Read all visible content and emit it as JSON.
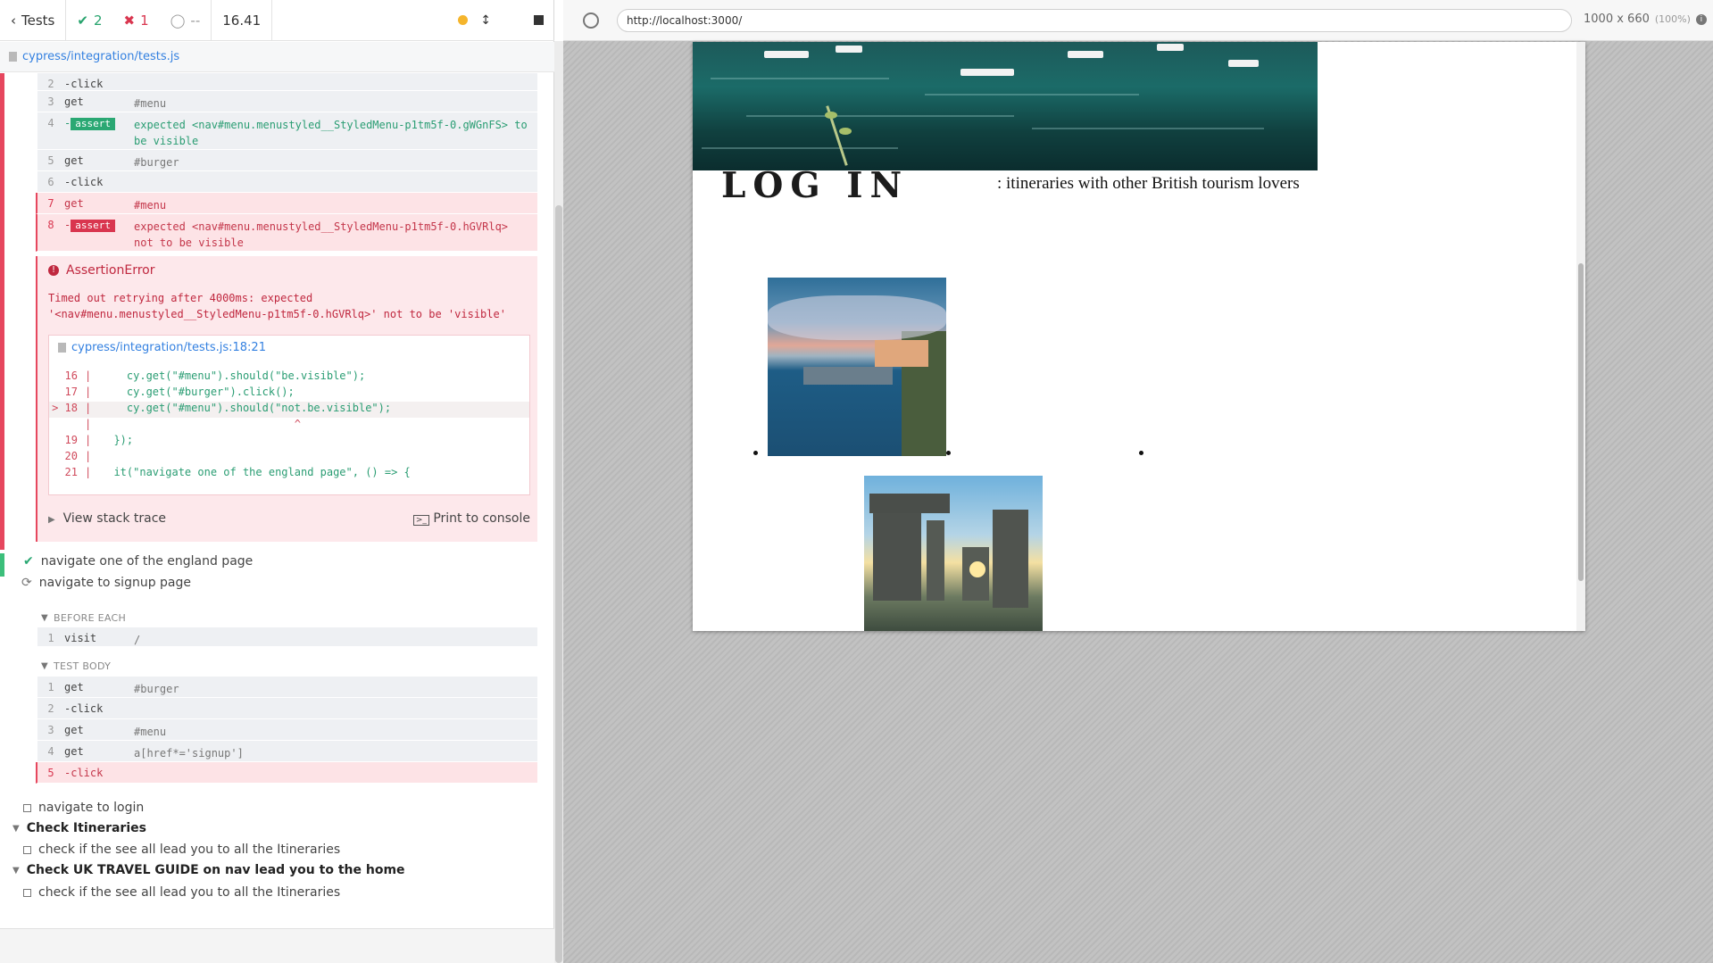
{
  "reporter": {
    "header": {
      "back_label": "Tests",
      "passed": "2",
      "failed": "1",
      "pending": "--",
      "duration": "16.41"
    },
    "spec_file": "cypress/integration/tests.js",
    "commands_top": [
      {
        "num": "2",
        "name": "-click",
        "msg": ""
      },
      {
        "num": "3",
        "name": "get",
        "msg": "#menu"
      },
      {
        "num": "4",
        "name": "-",
        "badge": "assert",
        "msg": "expected <nav#menu.menustyled__StyledMenu-p1tm5f-0.gWGnFS> to be visible"
      },
      {
        "num": "5",
        "name": "get",
        "msg": "#burger"
      },
      {
        "num": "6",
        "name": "-click",
        "msg": ""
      },
      {
        "num": "7",
        "name": "get",
        "msg": "#menu"
      },
      {
        "num": "8",
        "name": "-",
        "badge": "assert",
        "msg": "expected <nav#menu.menustyled__StyledMenu-p1tm5f-0.hGVRlq> not to be visible"
      }
    ],
    "error": {
      "title": "AssertionError",
      "message_line1": "Timed out retrying after 4000ms: expected",
      "message_line2": "'<nav#menu.menustyled__StyledMenu-p1tm5f-0.hGVRlq>' not to be 'visible'",
      "code_file": "cypress/integration/tests.js:18:21",
      "code_lines": [
        {
          "ln": "16",
          "src": "    cy.get(\"#menu\").should(\"be.visible\");"
        },
        {
          "ln": "17",
          "src": "    cy.get(\"#burger\").click();"
        },
        {
          "ln": "> 18",
          "src": "    cy.get(\"#menu\").should(\"not.be.visible\");"
        },
        {
          "ln": "",
          "src": "                              ^"
        },
        {
          "ln": "19",
          "src": "  });"
        },
        {
          "ln": "20",
          "src": ""
        },
        {
          "ln": "21",
          "src": "  it(\"navigate one of the england page\", () => {"
        }
      ],
      "view_stack": "View stack trace",
      "print_console": "Print to console"
    },
    "tests": {
      "england": "navigate one of the england page",
      "signup": "navigate to signup page",
      "before_each": "BEFORE EACH",
      "test_body": "TEST BODY",
      "login": "navigate to login",
      "suite_itineraries": "Check Itineraries",
      "itineraries_test": "check if the see all lead you to all the Itineraries",
      "suite_nav": "Check UK TRAVEL GUIDE on nav lead you to the home",
      "nav_test": "check if the see all lead you to all the Itineraries"
    },
    "signup_before": [
      {
        "num": "1",
        "name": "visit",
        "msg": "/"
      }
    ],
    "signup_body": [
      {
        "num": "1",
        "name": "get",
        "msg": "#burger"
      },
      {
        "num": "2",
        "name": "-click",
        "msg": ""
      },
      {
        "num": "3",
        "name": "get",
        "msg": "#menu"
      },
      {
        "num": "4",
        "name": "get",
        "msg": "a[href*='signup']"
      },
      {
        "num": "5",
        "name": "-click",
        "msg": ""
      }
    ]
  },
  "aut": {
    "url": "http://localhost:3000/",
    "viewport": "1000 x 660",
    "zoom": "(100%)",
    "login_title": "LOG IN",
    "subtitle": ": itineraries with other British tourism lovers"
  }
}
